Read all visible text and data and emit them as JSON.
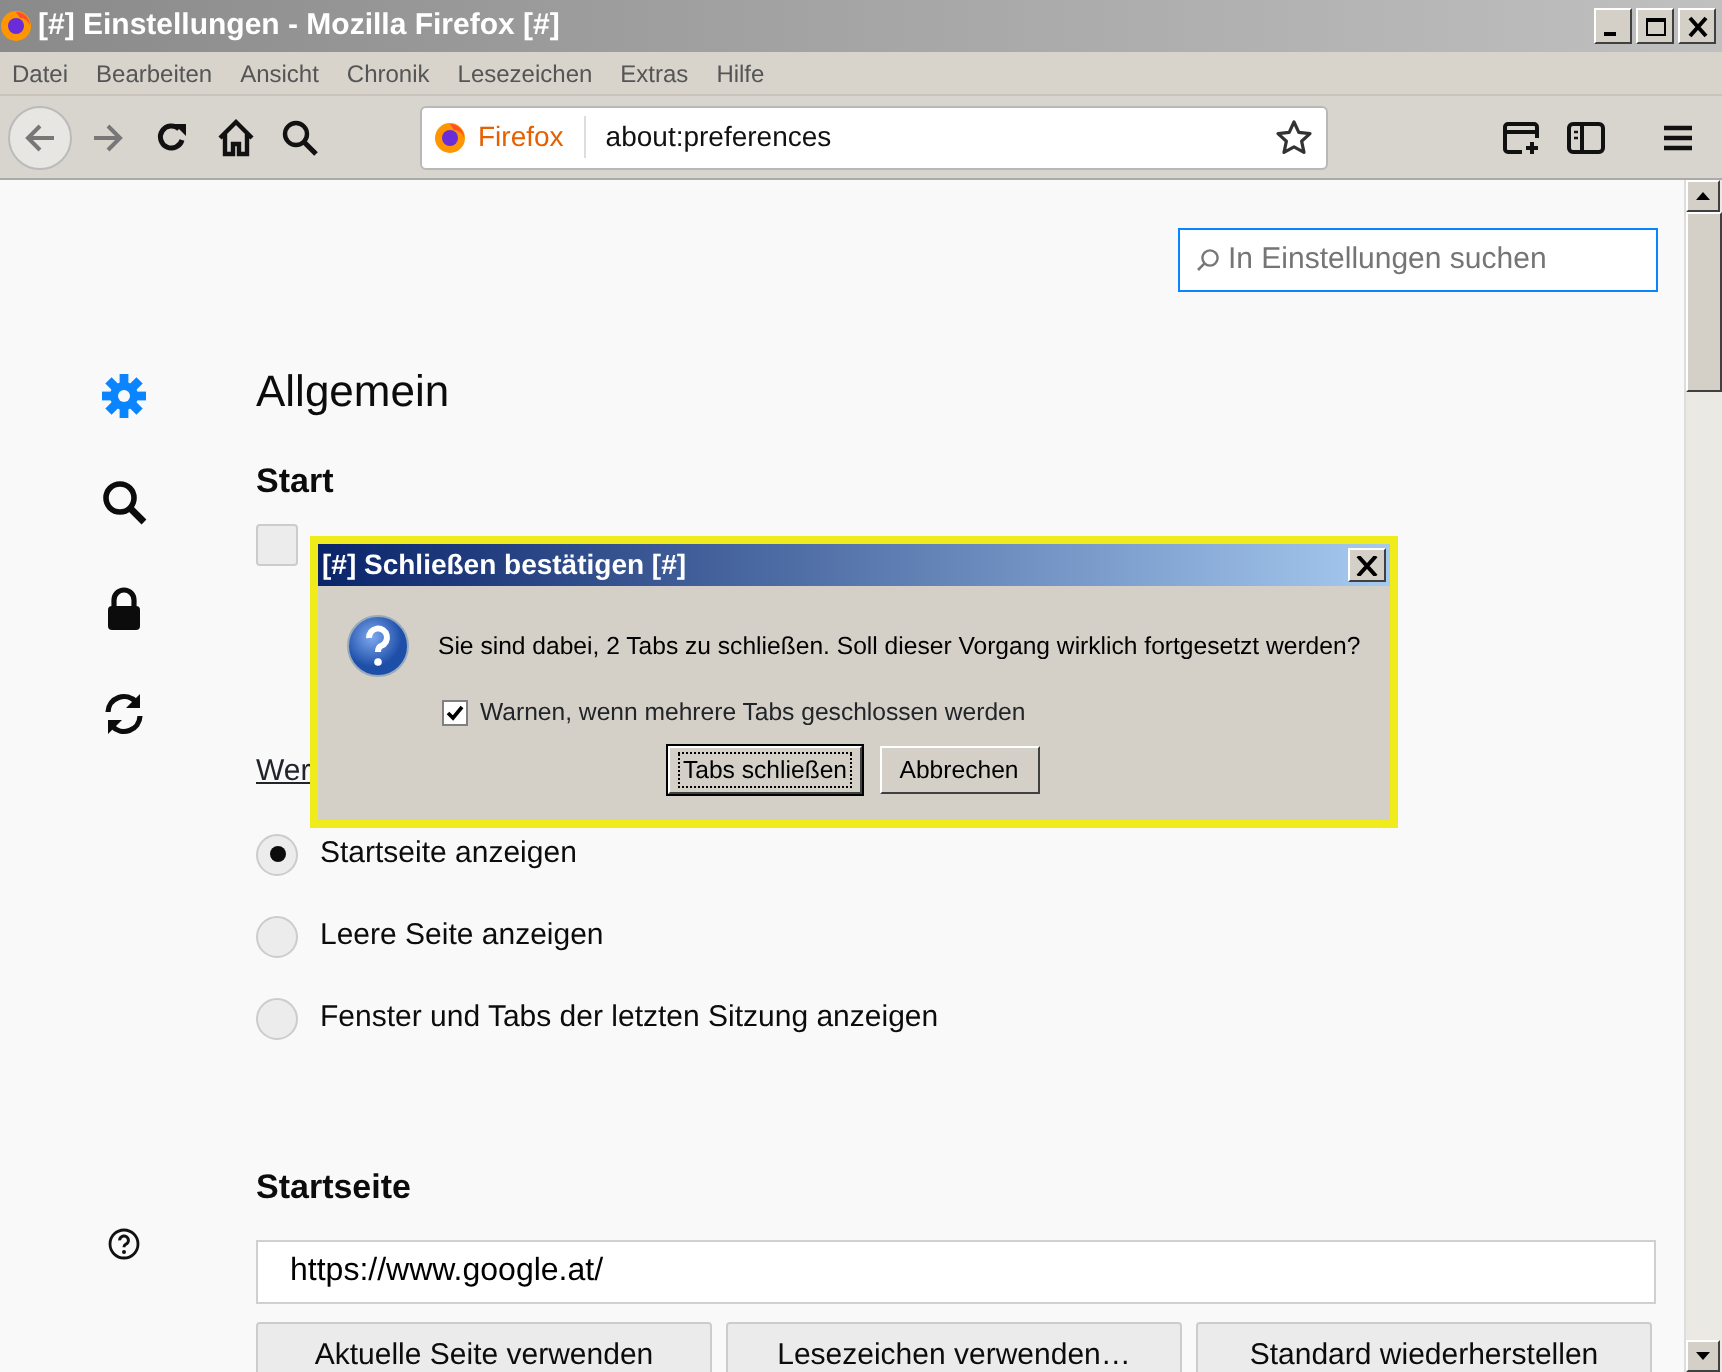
{
  "window": {
    "title": "[#] Einstellungen - Mozilla Firefox [#]"
  },
  "menu": [
    "Datei",
    "Bearbeiten",
    "Ansicht",
    "Chronik",
    "Lesezeichen",
    "Extras",
    "Hilfe"
  ],
  "url_bar": {
    "identity": "Firefox",
    "url": "about:preferences"
  },
  "search": {
    "placeholder": "In Einstellungen suchen"
  },
  "sidebar": {
    "items": [
      {
        "kind": "general",
        "selected": true
      },
      {
        "kind": "search",
        "selected": false
      },
      {
        "kind": "privacy",
        "selected": false
      },
      {
        "kind": "sync",
        "selected": false
      }
    ]
  },
  "heading": "Allgemein",
  "start": {
    "title": "Start",
    "checkbox_checked": false,
    "partial_label": "Wer",
    "options": [
      {
        "label": "Startseite anzeigen",
        "selected": true
      },
      {
        "label": "Leere Seite anzeigen",
        "selected": false
      },
      {
        "label": "Fenster und Tabs der letzten Sitzung anzeigen",
        "selected": false
      }
    ]
  },
  "homepage": {
    "title": "Startseite",
    "value": "https://www.google.at/",
    "buttons": [
      "Aktuelle Seite verwenden",
      "Lesezeichen verwenden…",
      "Standard wiederherstellen"
    ]
  },
  "dialog": {
    "title": "[#] Schließen bestätigen [#]",
    "message": "Sie sind dabei, 2 Tabs zu schließen. Soll dieser Vorgang wirklich fortgesetzt werden?",
    "checkbox": {
      "label": "Warnen, wenn mehrere Tabs geschlossen werden",
      "checked": true
    },
    "buttons": [
      {
        "label": "Tabs schließen",
        "default": true
      },
      {
        "label": "Abbrechen",
        "default": false
      }
    ]
  }
}
